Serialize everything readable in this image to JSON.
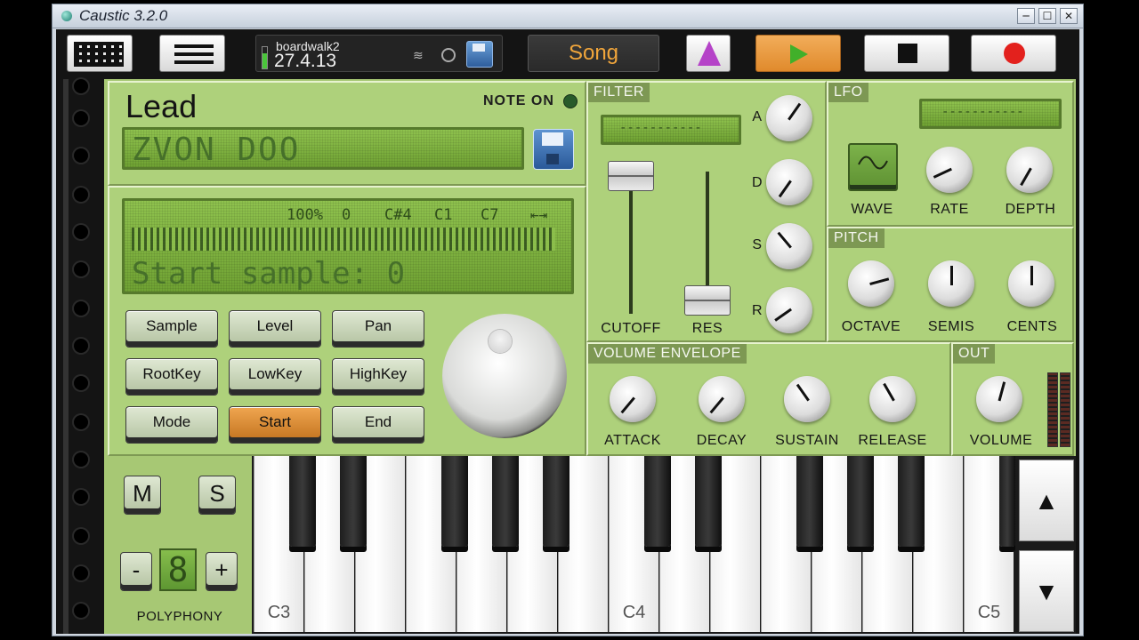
{
  "window": {
    "title": "Caustic 3.2.0",
    "controls": [
      "─",
      "☐",
      "✕"
    ]
  },
  "toolbar": {
    "song_name": "boardwalk2",
    "song_date": "27.4.13",
    "song_button": "Song"
  },
  "synth": {
    "machine_name": "Lead",
    "note_on_label": "NOTE ON",
    "preset_name": "ZVON DOO",
    "sample_lcd": {
      "params": [
        "100%",
        "0",
        "C#4",
        "C1",
        "C7"
      ],
      "status": "Start sample: 0"
    },
    "buttons": [
      "Sample",
      "Level",
      "Pan",
      "RootKey",
      "LowKey",
      "HighKey",
      "Mode",
      "Start",
      "End"
    ],
    "active_button": "Start"
  },
  "filter": {
    "title": "FILTER",
    "lcd": "-----------",
    "adsr_labels": [
      "A",
      "D",
      "S",
      "R"
    ],
    "cutoff_label": "CUTOFF",
    "res_label": "RES"
  },
  "lfo": {
    "title": "LFO",
    "lcd": "-----------",
    "wave_label": "WAVE",
    "rate_label": "RATE",
    "depth_label": "DEPTH"
  },
  "pitch": {
    "title": "PITCH",
    "octave_label": "OCTAVE",
    "semis_label": "SEMIS",
    "cents_label": "CENTS"
  },
  "volume_envelope": {
    "title": "VOLUME ENVELOPE",
    "attack_label": "ATTACK",
    "decay_label": "DECAY",
    "sustain_label": "SUSTAIN",
    "release_label": "RELEASE"
  },
  "out": {
    "title": "OUT",
    "volume_label": "VOLUME"
  },
  "keyboard": {
    "mute_label": "M",
    "solo_label": "S",
    "minus_label": "-",
    "plus_label": "+",
    "polyphony_value": "8",
    "polyphony_label": "POLYPHONY",
    "key_labels": [
      "C3",
      "C4",
      "C5"
    ],
    "up_arrow": "▲",
    "down_arrow": "▼"
  },
  "colors": {
    "panel": "#a7c874",
    "accent": "#f0a53b",
    "record": "#e3211d",
    "play": "#41b02a"
  }
}
